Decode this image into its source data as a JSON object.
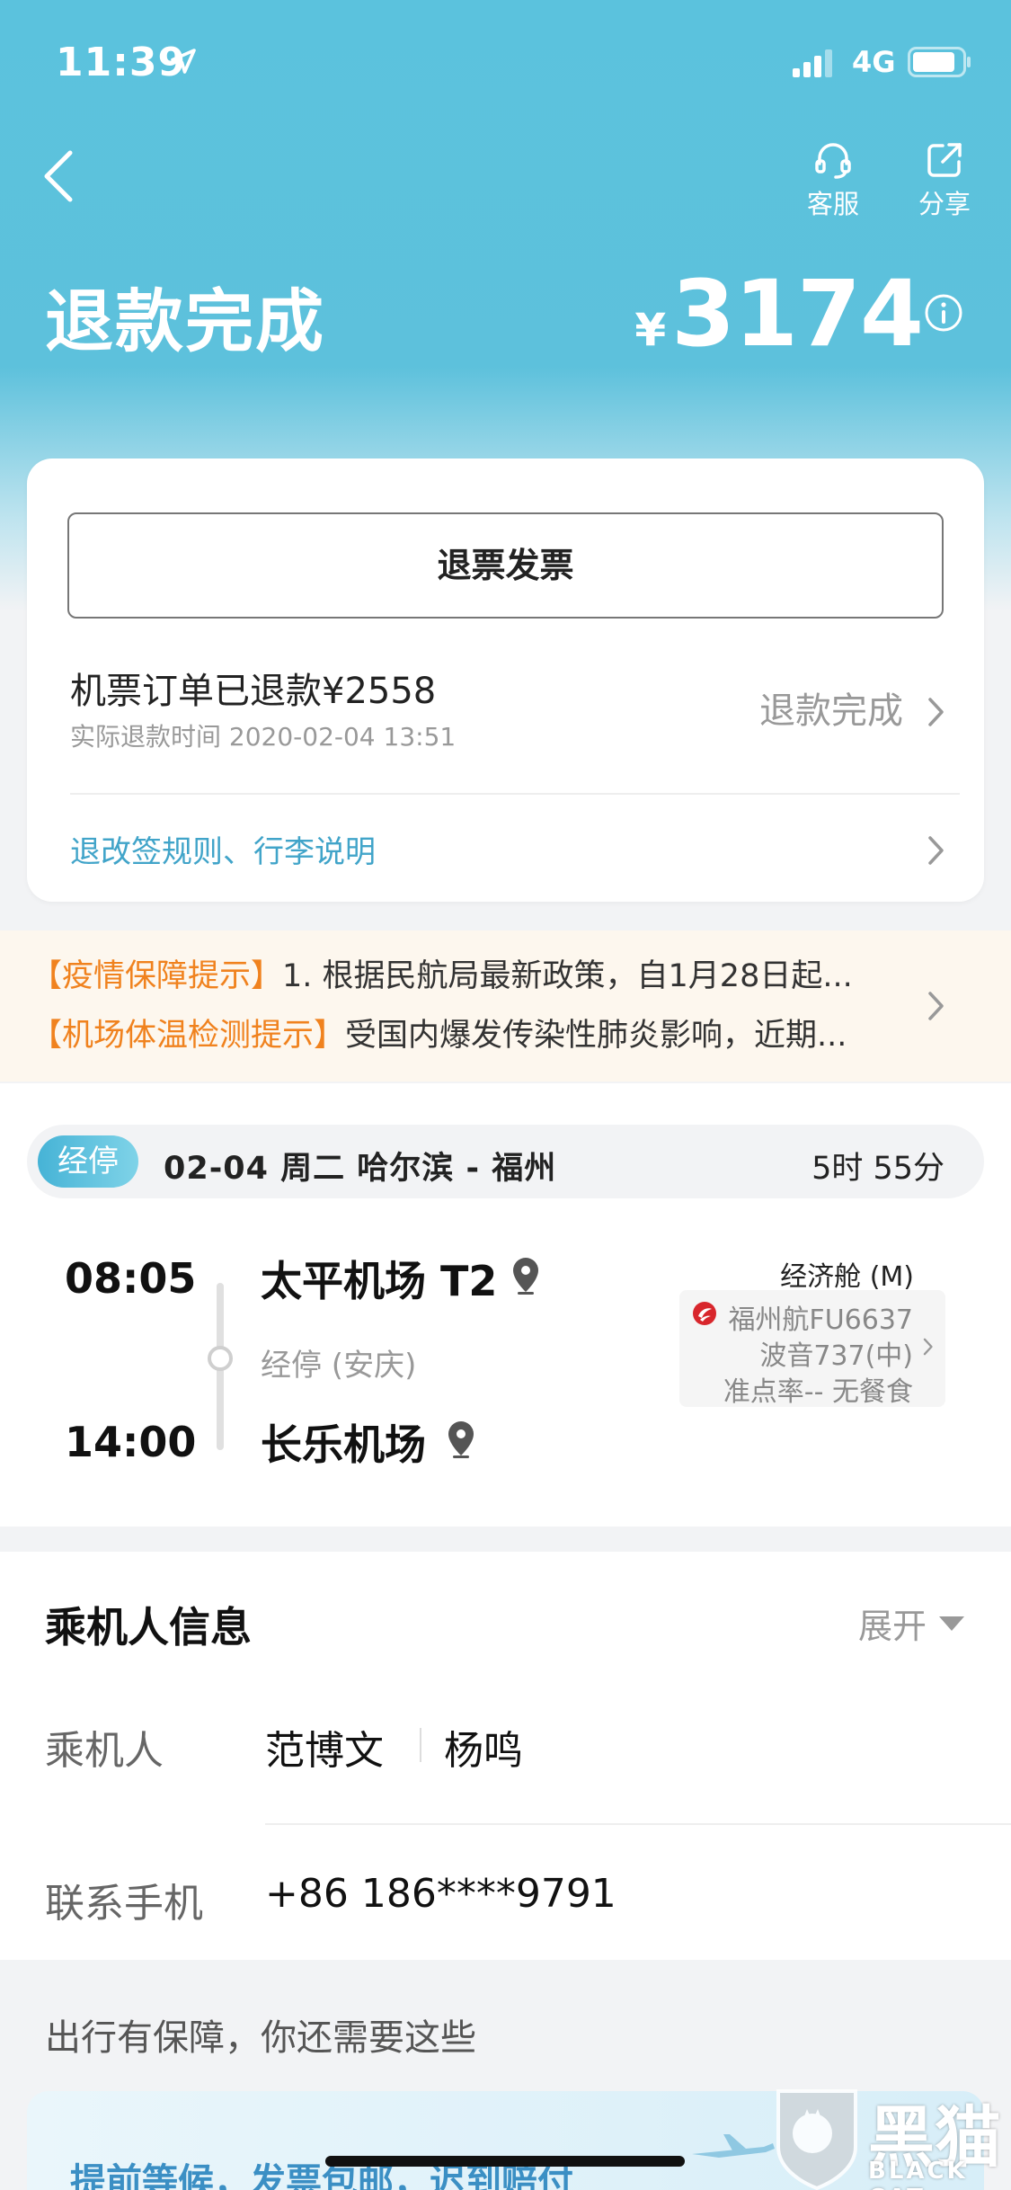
{
  "status_bar": {
    "time": "11:39",
    "network": "4G"
  },
  "header": {
    "actions": [
      {
        "label": "客服",
        "icon": "headset-icon"
      },
      {
        "label": "分享",
        "icon": "share-icon"
      }
    ],
    "title": "退款完成",
    "currency_symbol": "¥",
    "amount": "3174"
  },
  "refund_card": {
    "invoice_button": "退票发票",
    "refund_amount_text": "机票订单已退款¥2558",
    "refund_time_text": "实际退款时间 2020-02-04 13:51",
    "status": "退款完成",
    "rules_link": "退改签规则、行李说明"
  },
  "notices": [
    {
      "tag": "【疫情保障提示】",
      "text": "1. 根据民航局最新政策，自1月28日起..."
    },
    {
      "tag": "【机场体温检测提示】",
      "text": "受国内爆发传染性肺炎影响，近期..."
    }
  ],
  "flight": {
    "stop_badge": "经停",
    "route": "02-04  周二  哈尔滨 - 福州",
    "duration": "5时 55分",
    "departure_time": "08:05",
    "departure_airport": "太平机场 T2",
    "via": "经停 (安庆)",
    "arrival_time": "14:00",
    "arrival_airport": "长乐机场",
    "cabin": "经济舱 (M)",
    "airline_flight": "福州航FU6637",
    "aircraft": "波音737(中)",
    "punctuality_meal": "准点率-- 无餐食"
  },
  "passenger_info": {
    "title": "乘机人信息",
    "expand_label": "展开",
    "passenger_label": "乘机人",
    "passengers": [
      "范博文",
      "杨鸣"
    ],
    "phone_label": "联系手机",
    "phone": "+86 186****9791"
  },
  "extras": {
    "title": "出行有保障，你还需要这些",
    "promo_text": "提前等候，发票包邮，迟到赔付"
  },
  "watermark": {
    "cn": "黑猫",
    "en": "BLACK CAT"
  },
  "colors": {
    "header": "#5bc2dd",
    "link": "#41a4c9",
    "notice_tag": "#f0821e"
  }
}
